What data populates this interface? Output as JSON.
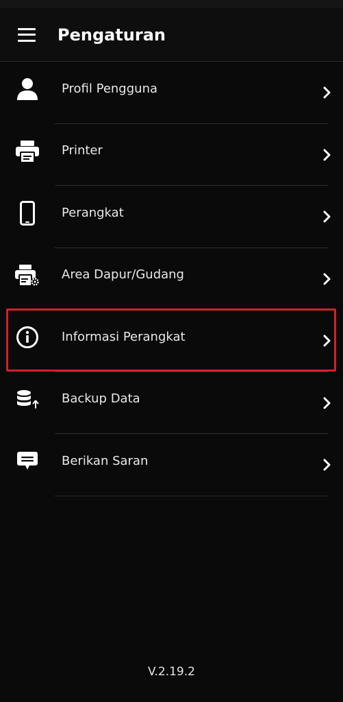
{
  "status_bar": {},
  "app_bar": {
    "title": "Pengaturan",
    "menu_icon": "hamburger-menu-icon"
  },
  "settings": {
    "items": [
      {
        "label": "Profil Pengguna",
        "icon": "user-icon"
      },
      {
        "label": "Printer",
        "icon": "printer-icon"
      },
      {
        "label": "Perangkat",
        "icon": "smartphone-icon"
      },
      {
        "label": "Area Dapur/Gudang",
        "icon": "printer-settings-icon"
      },
      {
        "label": "Informasi Perangkat",
        "icon": "info-circle-icon",
        "highlighted": true
      },
      {
        "label": "Backup Data",
        "icon": "database-upload-icon"
      },
      {
        "label": "Berikan Saran",
        "icon": "feedback-message-icon"
      }
    ],
    "chevron_icon": "chevron-right-icon"
  },
  "colors": {
    "background": "#0a0a0a",
    "app_bar": "#0e0e0e",
    "text": "#e6e6e6",
    "divider": "#2e2e2e",
    "highlight": "#d0222a"
  },
  "footer": {
    "version": "V.2.19.2"
  }
}
